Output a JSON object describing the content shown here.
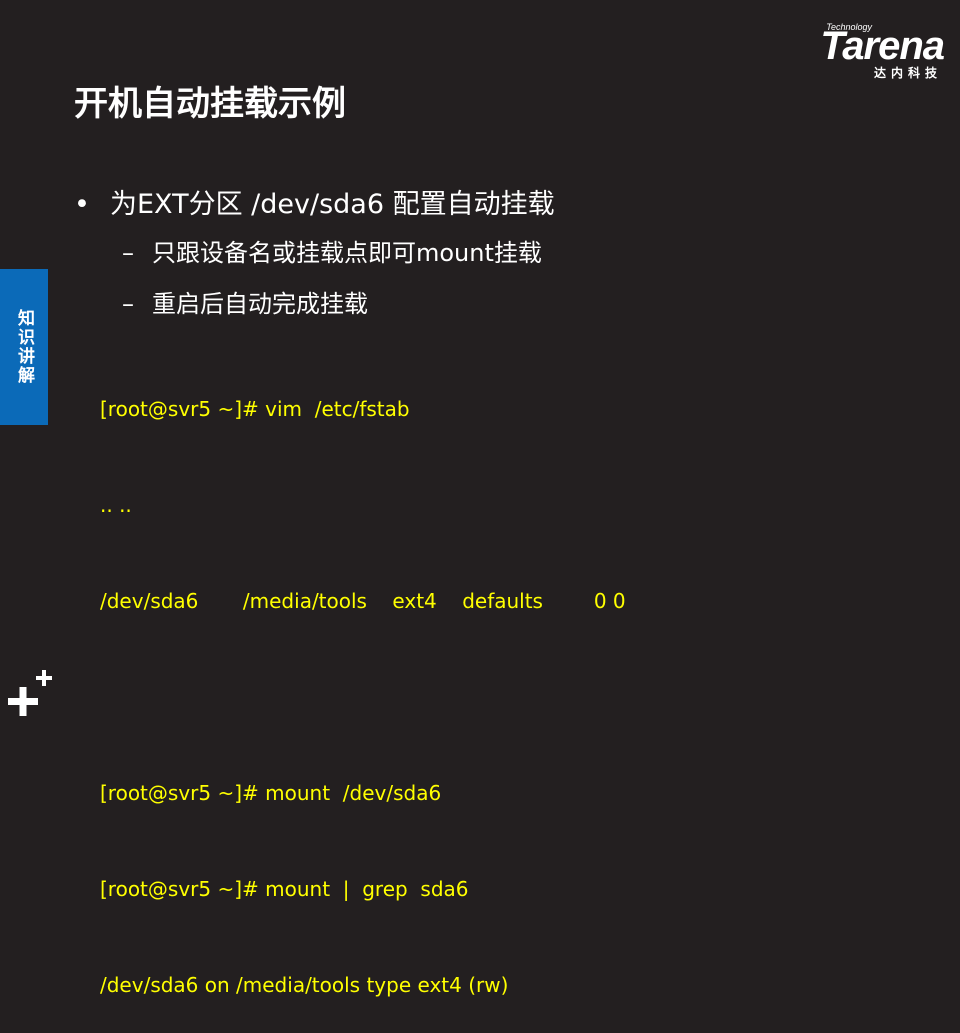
{
  "logo": {
    "technology": "Technology",
    "brand": "Tarena",
    "chinese": "达内科技"
  },
  "slide": {
    "title": "开机自动挂载示例",
    "side_tab": "知识讲解",
    "bullet": {
      "marker": "•",
      "text": "为EXT分区 /dev/sda6 配置自动挂载"
    },
    "sub_bullets": [
      {
        "marker": "–",
        "text": "只跟设备名或挂载点即可mount挂载"
      },
      {
        "marker": "–",
        "text": "重启后自动完成挂载"
      }
    ],
    "code_lines": [
      "[root@svr5 ~]# vim  /etc/fstab",
      ".. ..",
      "/dev/sda6       /media/tools    ext4    defaults        0 0",
      "",
      "[root@svr5 ~]# mount  /dev/sda6",
      "[root@svr5 ~]# mount  |  grep  sda6",
      "/dev/sda6 on /media/tools type ext4 (rw)"
    ]
  },
  "colors": {
    "background": "#231f20",
    "side_tab": "#0b6ab8",
    "code_text": "#ffff00"
  },
  "icons": {
    "corner": "plus-icon"
  }
}
